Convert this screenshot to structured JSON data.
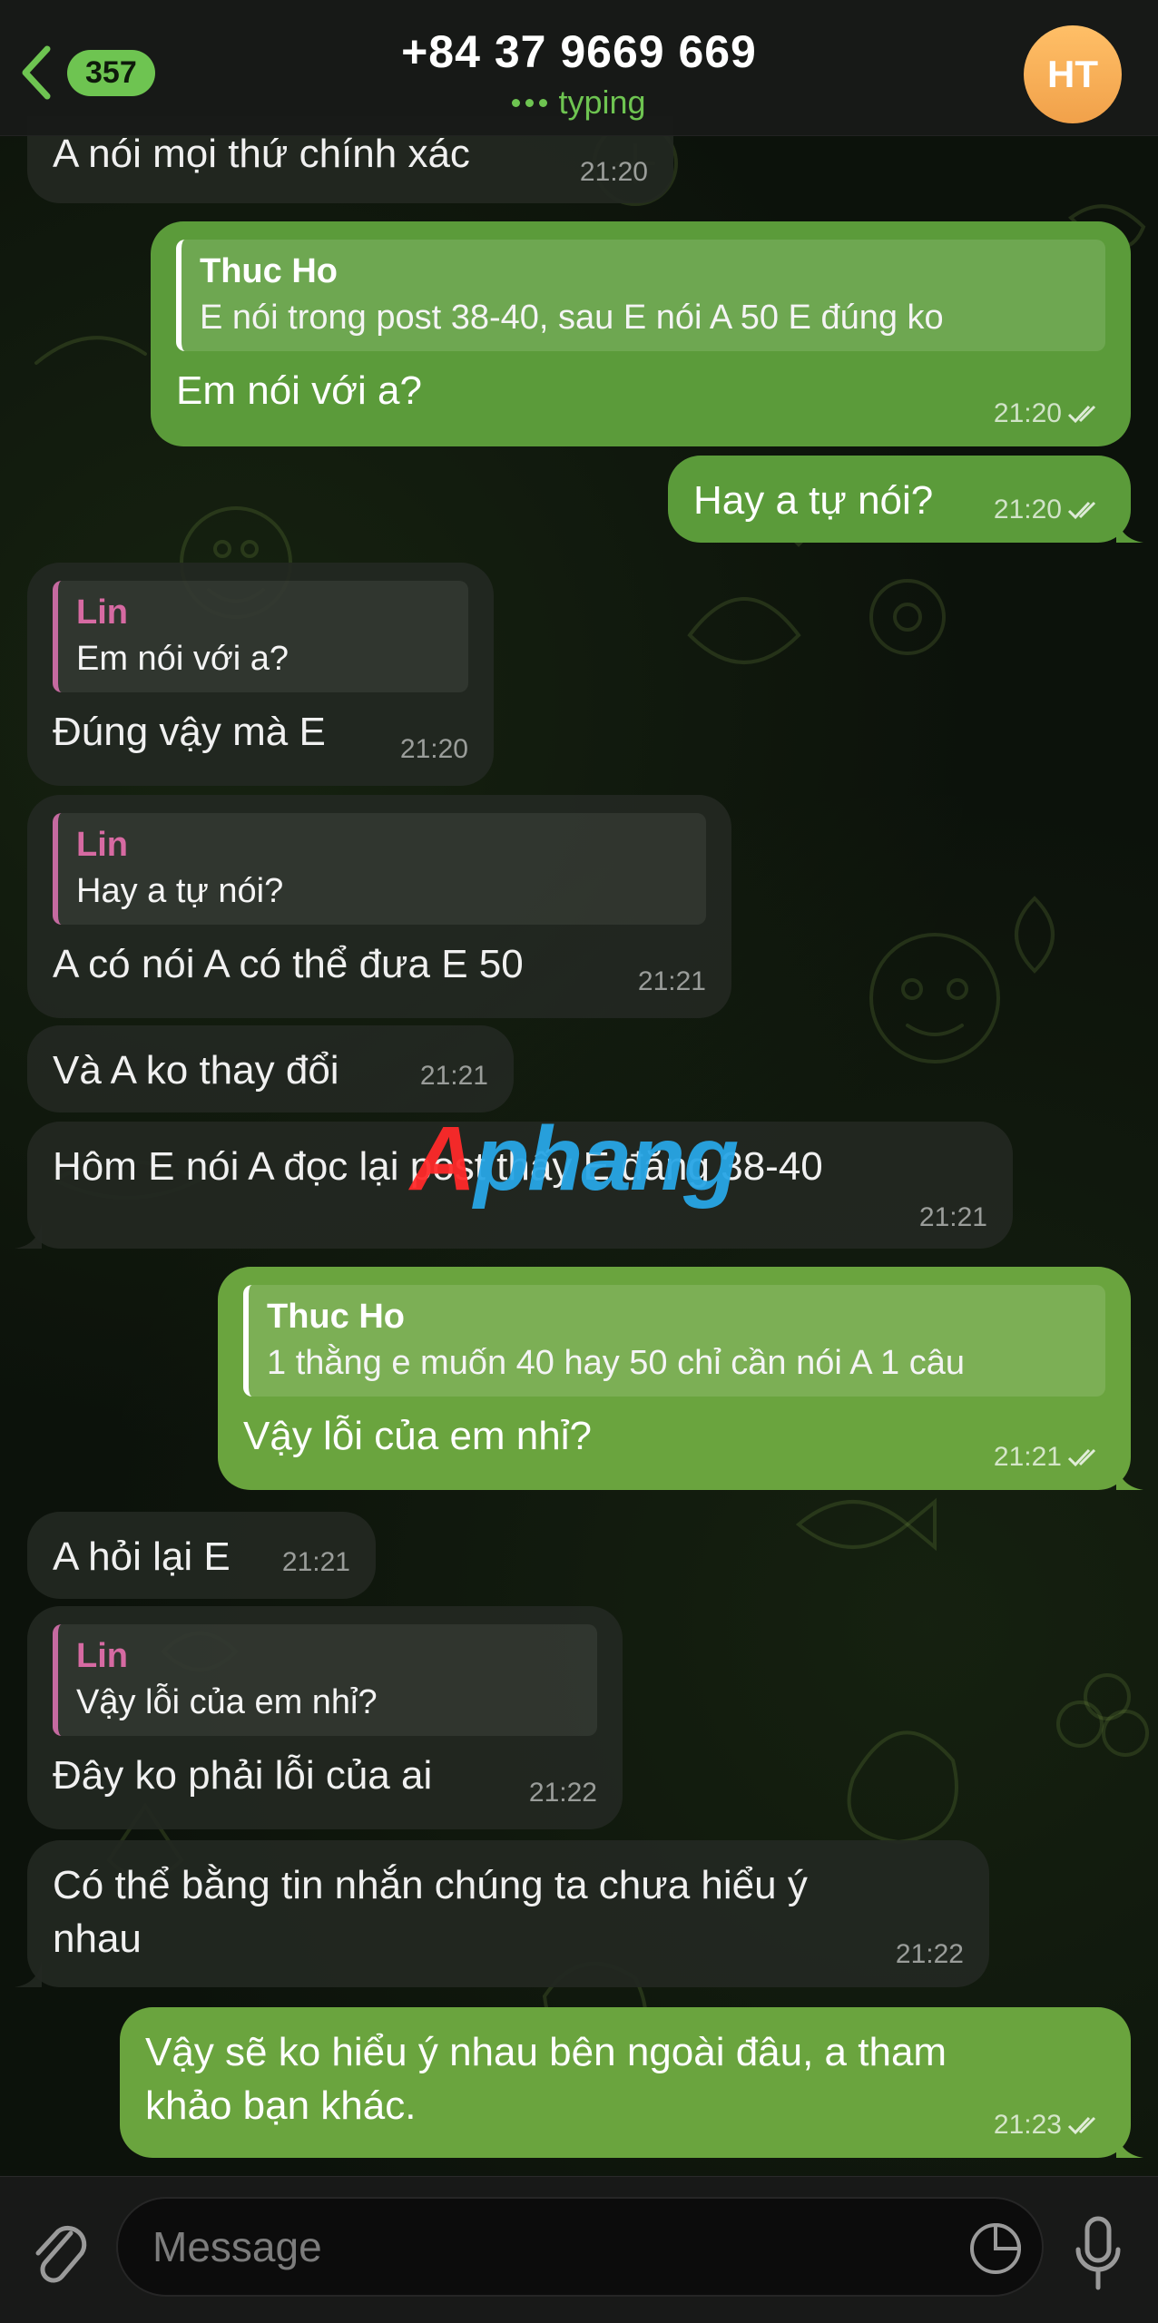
{
  "header": {
    "back_count": "357",
    "title": "+84 37 9669 669",
    "status": "typing",
    "avatar_initials": "HT"
  },
  "messages": [
    {
      "dir": "in",
      "text": "A nói mọi thứ chính xác",
      "time": "21:20"
    },
    {
      "dir": "out",
      "reply_name": "Thuc Ho",
      "reply_text": "E nói trong post 38-40, sau E nói A 50 E đúng ko",
      "text": "Em nói với a?",
      "time": "21:20"
    },
    {
      "dir": "out",
      "text": "Hay a tự nói?",
      "time": "21:20"
    },
    {
      "dir": "in",
      "reply_name": "Lin",
      "reply_text": "Em nói với a?",
      "text": "Đúng vậy mà E",
      "time": "21:20"
    },
    {
      "dir": "in",
      "reply_name": "Lin",
      "reply_text": "Hay a tự nói?",
      "text": "A có nói A có thể đưa E 50",
      "time": "21:21"
    },
    {
      "dir": "in",
      "text": "Và A ko thay đổi",
      "time": "21:21"
    },
    {
      "dir": "in",
      "text": "Hôm E nói A đọc lại post thấy E đăng 38-40",
      "time": "21:21"
    },
    {
      "dir": "out",
      "reply_name": "Thuc Ho",
      "reply_text": "1 thằng e muốn 40 hay 50 chỉ cần nói A 1 câu",
      "text": "Vậy lỗi của em nhỉ?",
      "time": "21:21"
    },
    {
      "dir": "in",
      "text": "A hỏi lại E",
      "time": "21:21"
    },
    {
      "dir": "in",
      "reply_name": "Lin",
      "reply_text": "Vậy lỗi của em nhỉ?",
      "text": "Đây ko phải lỗi của ai",
      "time": "21:22"
    },
    {
      "dir": "in",
      "text_line1": "Có thể bằng tin nhắn chúng ta chưa hiểu ý",
      "text_line2": "nhau",
      "time": "21:22"
    },
    {
      "dir": "out",
      "text_line1": "Vậy sẽ ko hiểu ý nhau bên ngoài đâu, a tham",
      "text_line2": "khảo bạn khác.",
      "time": "21:23"
    }
  ],
  "watermark": {
    "accent": "A",
    "rest": "phang"
  },
  "composer": {
    "placeholder": "Message"
  },
  "colors": {
    "accent_green": "#6ec451",
    "outgoing_bubble": "#5b9b3a",
    "incoming_bubble": "#222821",
    "reply_name_in": "#d66aa2"
  }
}
